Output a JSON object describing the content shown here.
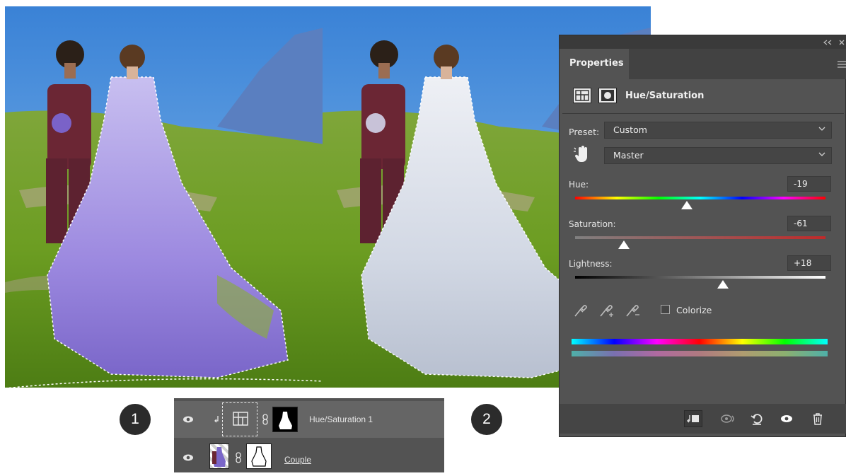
{
  "badges": {
    "one": "1",
    "two": "2"
  },
  "layers": {
    "rows": [
      {
        "name": "Hue/Saturation 1"
      },
      {
        "name": "Couple"
      }
    ]
  },
  "properties": {
    "tab_label": "Properties",
    "adjustment_title": "Hue/Saturation",
    "preset_label": "Preset:",
    "preset_value": "Custom",
    "channel_value": "Master",
    "hue": {
      "label": "Hue:",
      "value": "-19",
      "level": -19,
      "min": -180,
      "max": 180
    },
    "saturation": {
      "label": "Saturation:",
      "value": "-61",
      "level": -61,
      "min": -100,
      "max": 100
    },
    "lightness": {
      "label": "Lightness:",
      "value": "+18",
      "level": 18,
      "min": -100,
      "max": 100
    },
    "colorize_label": "Colorize",
    "colorize_checked": false
  },
  "icons": [
    "eye-icon",
    "chain-link-icon",
    "clip-arrow-icon",
    "eyedropper-icon",
    "hand-target-icon",
    "delete-icon",
    "reset-icon",
    "visibility-icon"
  ],
  "colors": {
    "panel_bg": "#535353",
    "panel_dark": "#424242",
    "selected_layer": "#656565"
  }
}
